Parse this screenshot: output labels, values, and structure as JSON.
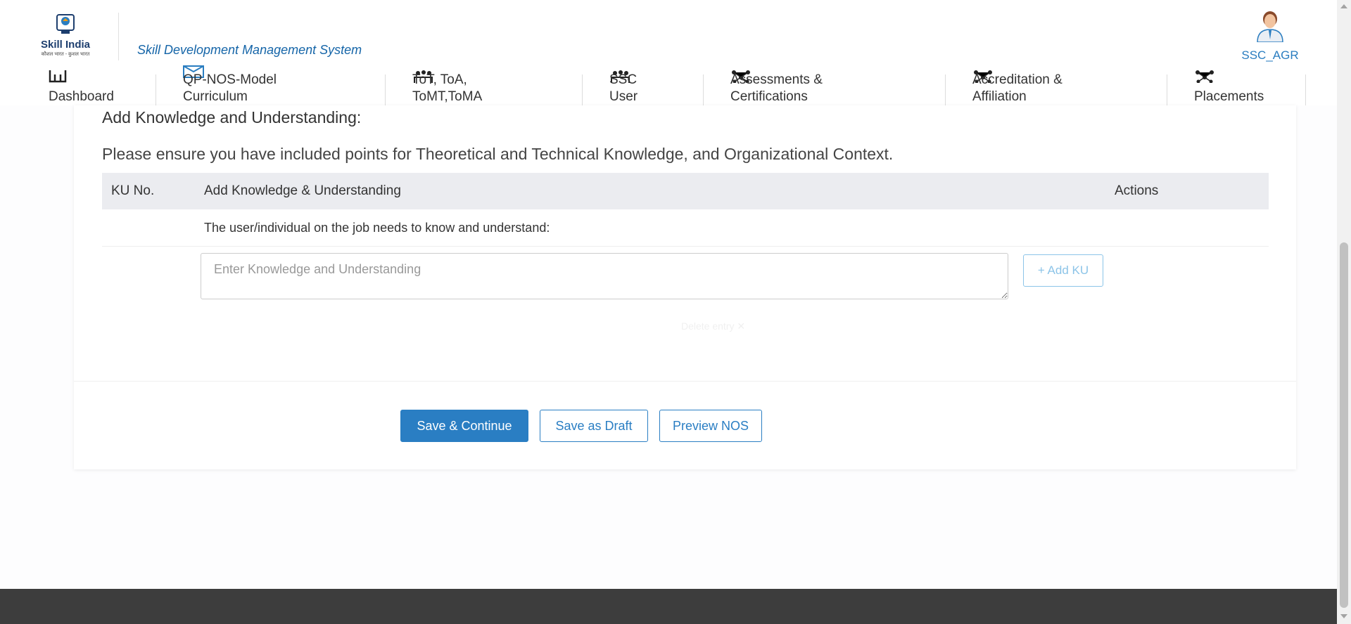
{
  "header": {
    "logo_name": "Skill India",
    "logo_tagline": "कौशल भारत - कुशल भारत",
    "app_title": "Skill Development Management System",
    "user_name": "SSC_AGR"
  },
  "nav": {
    "items": [
      {
        "label": "Dashboard"
      },
      {
        "label": "QP-NOS-Model\nCurriculum"
      },
      {
        "label": "ToT, ToA,\nToMT,ToMA"
      },
      {
        "label": "SSC\nUser"
      },
      {
        "label": "Assessments &\nCertifications"
      },
      {
        "label": "Accreditation &\nAffiliation"
      },
      {
        "label": "Placements"
      }
    ]
  },
  "section": {
    "title": "Add Knowledge and Understanding:",
    "note": "Please ensure you have included points for Theoretical and Technical Knowledge, and Organizational Context."
  },
  "table": {
    "headers": [
      "KU No.",
      "Add Knowledge & Understanding",
      "Actions"
    ],
    "intro_text": "The user/individual on the job needs to know and understand:"
  },
  "ku_input": {
    "placeholder": "Enter Knowledge and Understanding",
    "value": ""
  },
  "add_ku_label": "+ Add KU",
  "faint_text": "Delete entry  ✕",
  "actions": {
    "save_continue": "Save & Continue",
    "save_draft": "Save as Draft",
    "preview": "Preview NOS"
  },
  "colors": {
    "primary": "#2a7ec3",
    "title_blue": "#1565a8",
    "table_header_bg": "#ebecf0",
    "footer": "#3d3d3d"
  }
}
